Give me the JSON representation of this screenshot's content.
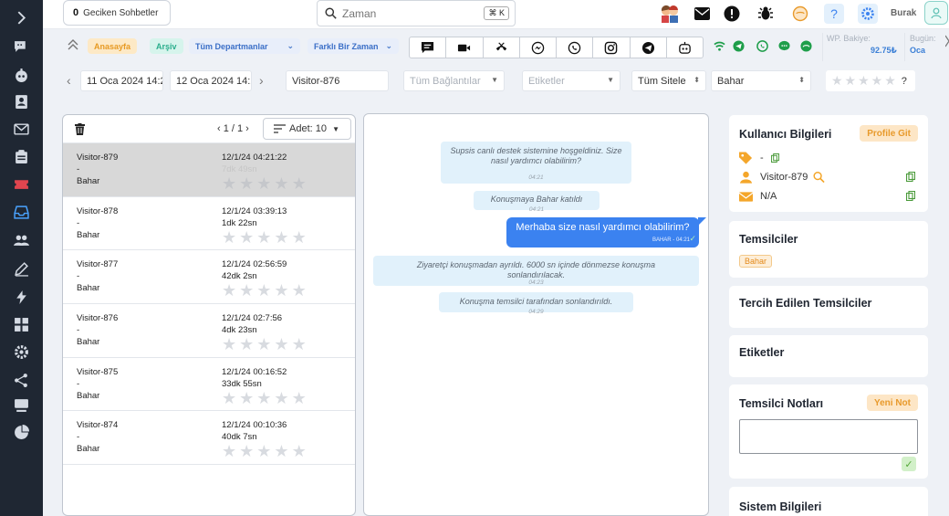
{
  "header": {
    "late_chats_count": "0",
    "late_chats_label": "Geciken Sohbetler",
    "search_placeholder": "Zaman",
    "search_shortcut": "⌘ K",
    "user_name": "Burak"
  },
  "toolbar": {
    "home_label": "Anasayfa",
    "archive_label": "Arşiv",
    "department_select": "Tüm Departmanlar",
    "time_select": "Farklı Bir Zaman",
    "channels": [
      "chat-icon",
      "video-icon",
      "phone-icon",
      "messenger-icon",
      "whatsapp-icon",
      "instagram-icon",
      "telegram-icon",
      "bot-icon"
    ],
    "wp_label": "WP. Bakiye:",
    "wp_value": "92.75₺",
    "today_label": "Bugün:",
    "today_value": "Oca"
  },
  "filters": {
    "date_from": "11 Oca 2024 14:2",
    "date_to": "12 Oca 2024 14:2",
    "visitor": "Visitor-876",
    "connections_placeholder": "Tüm Bağlantılar",
    "tags_placeholder": "Etiketler",
    "sites_select": "Tüm Sitele",
    "agent_select": "Bahar",
    "rating_help": "?"
  },
  "chat_list": {
    "pager": "‹ 1 / 1 ›",
    "count_label": "Adet: 10",
    "rows": [
      {
        "visitor": "Visitor-879",
        "dash": "-",
        "agent": "Bahar",
        "datetime": "12/1/24 04:21:22",
        "duration": "7dk 49sn",
        "selected": true
      },
      {
        "visitor": "Visitor-878",
        "dash": "-",
        "agent": "Bahar",
        "datetime": "12/1/24 03:39:13",
        "duration": "1dk 22sn",
        "selected": false
      },
      {
        "visitor": "Visitor-877",
        "dash": "-",
        "agent": "Bahar",
        "datetime": "12/1/24 02:56:59",
        "duration": "42dk 2sn",
        "selected": false
      },
      {
        "visitor": "Visitor-876",
        "dash": "-",
        "agent": "Bahar",
        "datetime": "12/1/24 02:7:56",
        "duration": "4dk 23sn",
        "selected": false
      },
      {
        "visitor": "Visitor-875",
        "dash": "-",
        "agent": "Bahar",
        "datetime": "12/1/24 00:16:52",
        "duration": "33dk 55sn",
        "selected": false
      },
      {
        "visitor": "Visitor-874",
        "dash": "-",
        "agent": "Bahar",
        "datetime": "12/1/24 00:10:36",
        "duration": "40dk 7sn",
        "selected": false
      }
    ]
  },
  "conversation": {
    "welcome_text": "Supsis canlı destek sistemine hoşgeldiniz. Size nasıl yardımcı olabilirim?",
    "welcome_time": "04:21",
    "joined_text": "Konuşmaya Bahar katıldı",
    "joined_time": "04:21",
    "agent_text": "Merhaba size nasıl yardımcı olabilirim?",
    "agent_meta": "BAHAR - 04:21",
    "left_text": "Ziyaretçi konuşmadan ayrıldı. 6000 sn içinde dönmezse konuşma sonlandırılacak.",
    "left_time": "04:23",
    "ended_text": "Konuşma temsilci tarafından sonlandırıldı.",
    "ended_time": "04:29"
  },
  "right_panel": {
    "user_info_title": "Kullanıcı Bilgileri",
    "profile_button": "Profile Git",
    "tag_value": "-",
    "visitor_name": "Visitor-879",
    "email_value": "N/A",
    "agents_title": "Temsilciler",
    "agent_tag": "Bahar",
    "preferred_title": "Tercih Edilen Temsilciler",
    "tags_title": "Etiketler",
    "notes_title": "Temsilci Notları",
    "new_note_button": "Yeni Not",
    "system_title": "Sistem Bilgileri"
  },
  "colors": {
    "sidebar": "#1f2733",
    "accent_blue": "#3b82f0",
    "orange": "#e89a2c",
    "green": "#2aae8c"
  }
}
